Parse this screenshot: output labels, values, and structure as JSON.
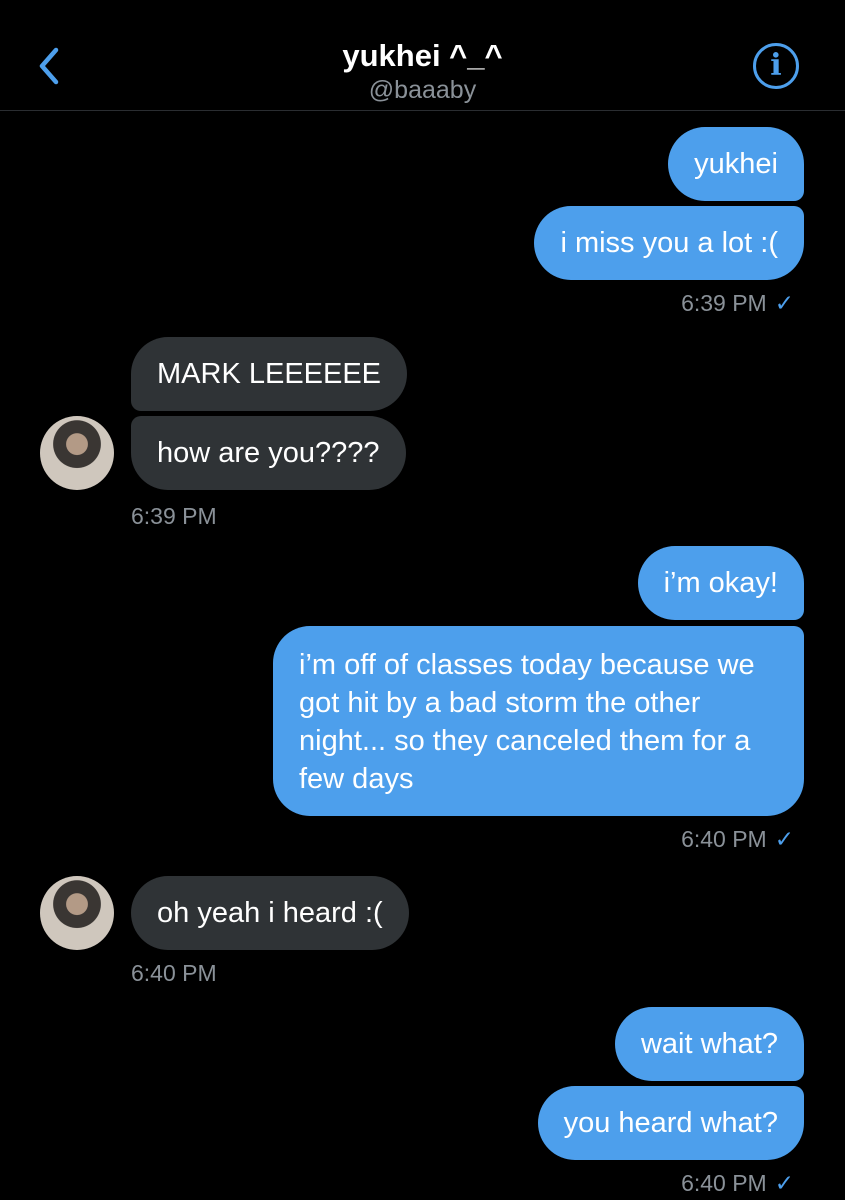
{
  "header": {
    "title": "yukhei ^_^",
    "handle": "@baaaby",
    "info_glyph": "i",
    "back_icon": "chevron-left-icon",
    "info_icon": "info-circle-icon"
  },
  "colors": {
    "background": "#000000",
    "outgoing_bubble": "#4d9fec",
    "incoming_bubble": "#2f3336",
    "accent": "#4d9fec",
    "muted_text": "#8a9198"
  },
  "messages": [
    {
      "side": "out",
      "text": "yukhei"
    },
    {
      "side": "out",
      "text": "i miss you a lot :("
    },
    {
      "side": "in",
      "text": "MARK LEEEEEE"
    },
    {
      "side": "in",
      "text": "how are you????"
    },
    {
      "side": "out",
      "text": "i’m okay!"
    },
    {
      "side": "out",
      "text": "i’m off of classes today because we got hit by a bad storm the other night... so they canceled them for a few days"
    },
    {
      "side": "in",
      "text": "oh yeah i heard :("
    },
    {
      "side": "out",
      "text": "wait what?"
    },
    {
      "side": "out",
      "text": "you heard what?"
    }
  ],
  "timestamps": [
    {
      "side": "out",
      "text": "6:39 PM",
      "read_check": "✓"
    },
    {
      "side": "in",
      "text": "6:39 PM"
    },
    {
      "side": "out",
      "text": "6:40 PM",
      "read_check": "✓"
    },
    {
      "side": "in",
      "text": "6:40 PM"
    },
    {
      "side": "out",
      "text": "6:40 PM",
      "read_check": "✓"
    }
  ]
}
